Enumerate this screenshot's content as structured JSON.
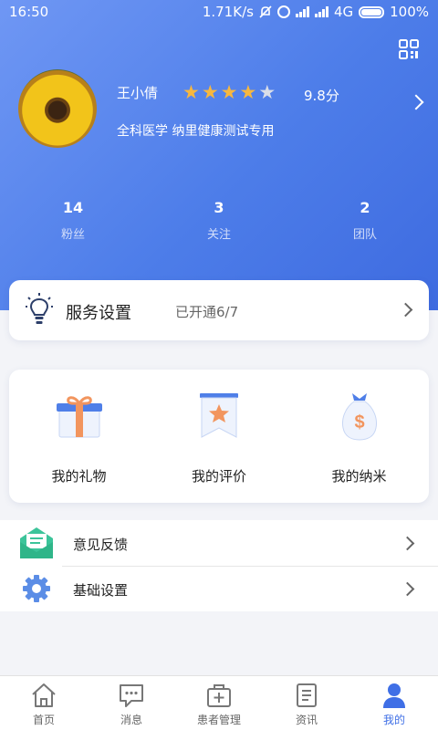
{
  "status_bar": {
    "time": "16:50",
    "network_speed": "1.71K/s",
    "network_type": "4G",
    "battery": "100%"
  },
  "profile": {
    "name": "王小倩",
    "rating": 4,
    "rating_max": 5,
    "score": "9.8分",
    "subtitle": "全科医学  纳里健康测试专用"
  },
  "stats": [
    {
      "value": "14",
      "label": "粉丝"
    },
    {
      "value": "3",
      "label": "关注"
    },
    {
      "value": "2",
      "label": "团队"
    }
  ],
  "service": {
    "title": "服务设置",
    "status": "已开通6/7"
  },
  "grid": [
    {
      "label": "我的礼物",
      "icon": "gift-icon"
    },
    {
      "label": "我的评价",
      "icon": "rating-ribbon-icon"
    },
    {
      "label": "我的纳米",
      "icon": "money-bag-icon"
    }
  ],
  "menu": [
    {
      "label": "意见反馈",
      "icon": "feedback-envelope-icon"
    },
    {
      "label": "基础设置",
      "icon": "gear-icon"
    }
  ],
  "tabs": [
    {
      "label": "首页",
      "icon": "home-icon",
      "active": false
    },
    {
      "label": "消息",
      "icon": "message-icon",
      "active": false
    },
    {
      "label": "患者管理",
      "icon": "medical-kit-icon",
      "active": false
    },
    {
      "label": "资讯",
      "icon": "document-icon",
      "active": false
    },
    {
      "label": "我的",
      "icon": "person-icon",
      "active": true
    }
  ],
  "colors": {
    "primary": "#4d7de9",
    "star": "#f7b73f",
    "active_tab": "#3f6fe6",
    "feedback_green": "#3cc49a",
    "gear_blue": "#5b8de6"
  }
}
